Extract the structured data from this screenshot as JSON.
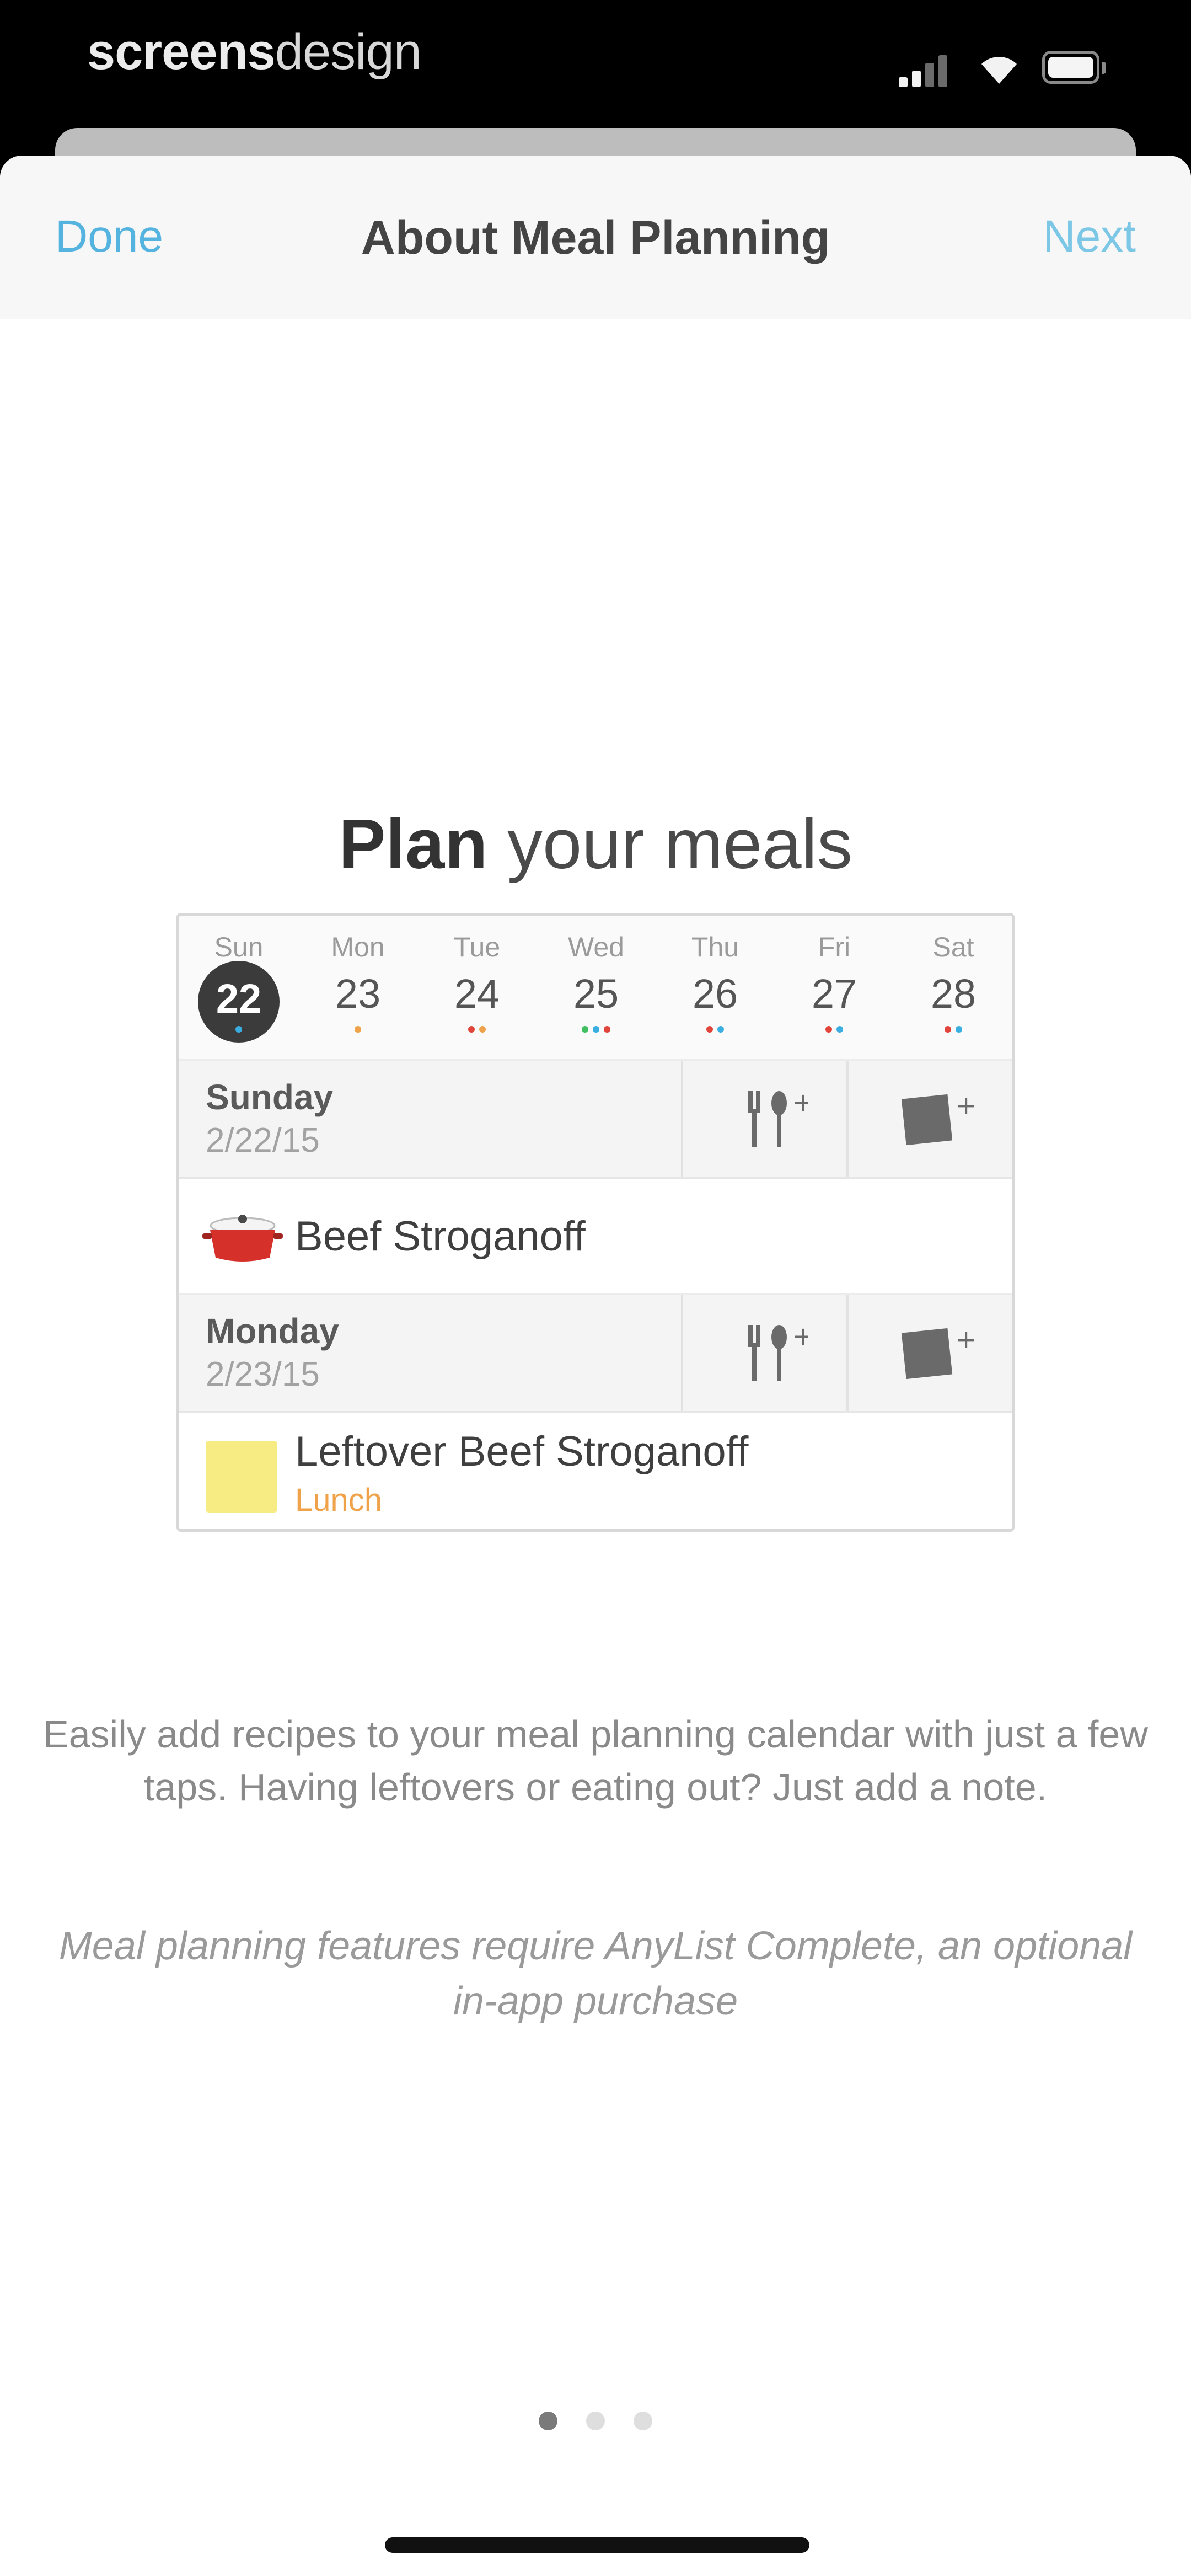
{
  "status_bar": {
    "carrier_bold": "screens",
    "carrier_light": "design"
  },
  "nav": {
    "left_button": "Done",
    "title": "About Meal Planning",
    "right_button": "Next"
  },
  "headline": {
    "bold": "Plan",
    "rest": " your meals"
  },
  "calendar": {
    "days": [
      {
        "name": "Sun",
        "number": "22",
        "selected": true,
        "dots": [
          "#3aaee0"
        ]
      },
      {
        "name": "Mon",
        "number": "23",
        "selected": false,
        "dots": [
          "#f0a24a"
        ]
      },
      {
        "name": "Tue",
        "number": "24",
        "selected": false,
        "dots": [
          "#e0443a",
          "#f0a24a"
        ]
      },
      {
        "name": "Wed",
        "number": "25",
        "selected": false,
        "dots": [
          "#3fbf5f",
          "#3aaee0",
          "#e0443a"
        ]
      },
      {
        "name": "Thu",
        "number": "26",
        "selected": false,
        "dots": [
          "#e0443a",
          "#3aaee0"
        ]
      },
      {
        "name": "Fri",
        "number": "27",
        "selected": false,
        "dots": [
          "#e0443a",
          "#3aaee0"
        ]
      },
      {
        "name": "Sat",
        "number": "28",
        "selected": false,
        "dots": [
          "#e0443a",
          "#3aaee0"
        ]
      }
    ],
    "sections": [
      {
        "day": "Sunday",
        "date": "2/22/15",
        "entry_title": "Beef Stroganoff",
        "entry_subtitle": "",
        "entry_icon": "pot-icon"
      },
      {
        "day": "Monday",
        "date": "2/23/15",
        "entry_title": "Leftover Beef Stroganoff",
        "entry_subtitle": "Lunch",
        "entry_icon": "note-icon"
      }
    ]
  },
  "description": "Easily add recipes to your meal planning calendar with just a few taps. Having leftovers or eating out? Just add a note.",
  "purchase_note": "Meal planning features require AnyList Complete, an optional in-app purchase",
  "pager": {
    "count": 3,
    "active_index": 0
  },
  "colors": {
    "accent": "#55b3e0",
    "lunch": "#f0a24a",
    "note_yellow": "#f6ec83",
    "pot_red": "#d6302a"
  }
}
